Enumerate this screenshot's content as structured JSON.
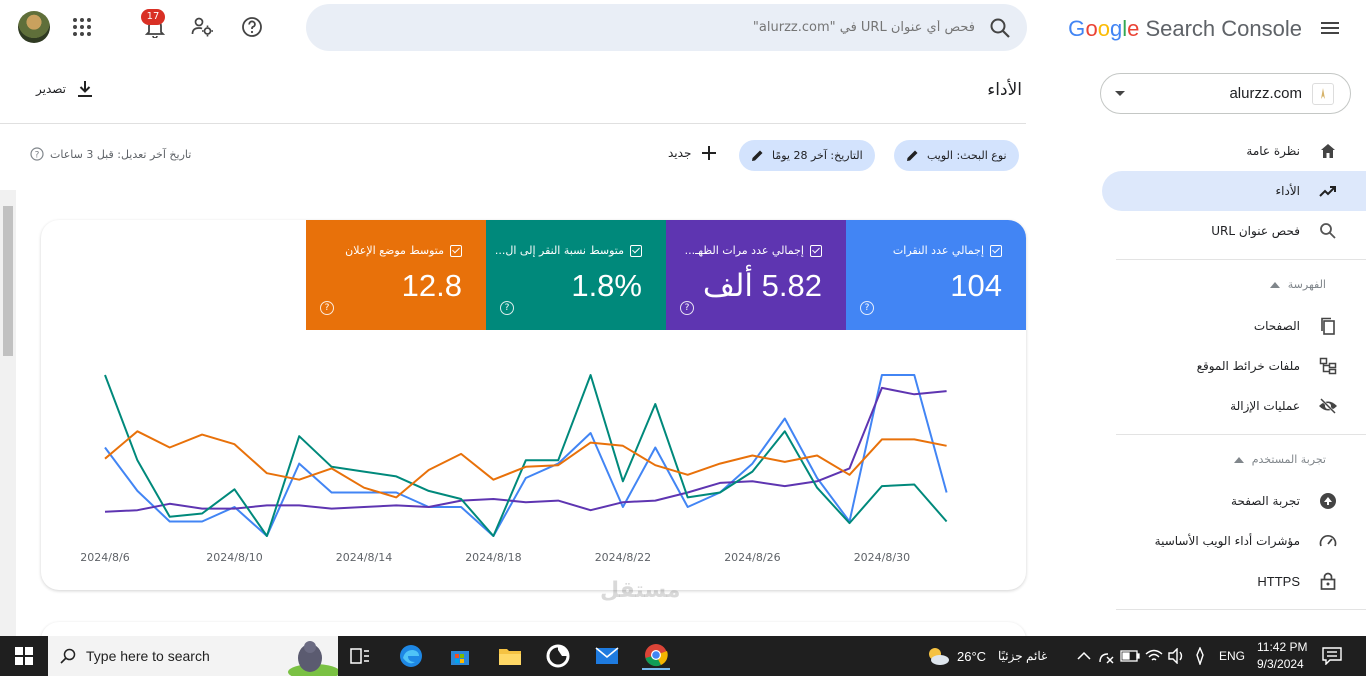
{
  "app": {
    "brand": "Google Search Console"
  },
  "property": {
    "name": "alurzz.com"
  },
  "search": {
    "placeholder": "فحص أي عنوان URL في \"alurzz.com\""
  },
  "notifications": {
    "count": "17"
  },
  "header": {
    "title": "الأداء",
    "export_label": "تصدير"
  },
  "filters": {
    "search_type": "نوع البحث: الويب",
    "date": "التاريخ: آخر 28 يومًا",
    "new_label": "جديد",
    "updated": "تاريخ آخر تعديل: قبل 3 ساعات"
  },
  "sidebar": {
    "items": [
      {
        "label": "نظرة عامة",
        "icon": "home-icon"
      },
      {
        "label": "الأداء",
        "icon": "trending-up-icon",
        "active": true
      },
      {
        "label": "فحص عنوان URL",
        "icon": "search-icon"
      }
    ],
    "sections": [
      {
        "title": "الفهرسة",
        "items": [
          {
            "label": "الصفحات",
            "icon": "pages-icon"
          },
          {
            "label": "ملفات خرائط الموقع",
            "icon": "sitemap-icon"
          },
          {
            "label": "عمليات الإزالة",
            "icon": "eye-off-icon"
          }
        ]
      },
      {
        "title": "تجربة المستخدم",
        "items": [
          {
            "label": "تجربة الصفحة",
            "icon": "page-experience-icon"
          },
          {
            "label": "مؤشرات أداء الويب الأساسية",
            "icon": "speed-icon"
          },
          {
            "label": "HTTPS",
            "icon": "lock-icon"
          }
        ]
      }
    ]
  },
  "metrics": [
    {
      "label": "إجمالي عدد النقرات",
      "value": "104",
      "color": "#4285f4"
    },
    {
      "label": "إجمالي عدد مرات الظهـ...",
      "value": "5.82 ألف",
      "color": "#5e35b1"
    },
    {
      "label": "متوسط نسبة النقر إلى ال...",
      "value": "1.8%",
      "color": "#00897b"
    },
    {
      "label": "متوسط موضع الإعلان",
      "value": "12.8",
      "color": "#e8710a"
    }
  ],
  "chart_data": {
    "type": "line",
    "title": "",
    "xlabel": "",
    "ylabel": "",
    "x": [
      "2024/8/6",
      "2024/8/7",
      "2024/8/8",
      "2024/8/9",
      "2024/8/10",
      "2024/8/11",
      "2024/8/12",
      "2024/8/13",
      "2024/8/14",
      "2024/8/15",
      "2024/8/16",
      "2024/8/17",
      "2024/8/18",
      "2024/8/19",
      "2024/8/20",
      "2024/8/21",
      "2024/8/22",
      "2024/8/23",
      "2024/8/24",
      "2024/8/25",
      "2024/8/26",
      "2024/8/27",
      "2024/8/28",
      "2024/8/29",
      "2024/8/30",
      "2024/8/31",
      "2024/9/1",
      "2024/9/2"
    ],
    "xticks": [
      "2024/8/6",
      "2024/8/10",
      "2024/8/14",
      "2024/8/18",
      "2024/8/22",
      "2024/8/26",
      "2024/8/30"
    ],
    "ylim": [
      0,
      100
    ],
    "grid": false,
    "series": [
      {
        "color": "#4285f4",
        "values": [
          55,
          28,
          9,
          9,
          18,
          0,
          45,
          27,
          27,
          27,
          18,
          18,
          0,
          36,
          45,
          64,
          18,
          55,
          18,
          27,
          45,
          73,
          36,
          9,
          100,
          100,
          27
        ]
      },
      {
        "color": "#5e35b1",
        "values": [
          15,
          16,
          20,
          17,
          17,
          19,
          19,
          17,
          18,
          19,
          18,
          22,
          23,
          21,
          22,
          16,
          21,
          22,
          27,
          33,
          34,
          31,
          34,
          42,
          92,
          88,
          90
        ]
      },
      {
        "color": "#00897b",
        "values": [
          100,
          47,
          12,
          14,
          29,
          0,
          62,
          43,
          40,
          37,
          28,
          23,
          0,
          47,
          47,
          100,
          34,
          82,
          24,
          27,
          40,
          65,
          30,
          8,
          31,
          32,
          9
        ]
      },
      {
        "color": "#e8710a",
        "values": [
          48,
          65,
          55,
          63,
          57,
          39,
          35,
          42,
          30,
          24,
          41,
          51,
          35,
          43,
          44,
          58,
          56,
          44,
          38,
          45,
          50,
          46,
          50,
          38,
          60,
          60,
          56
        ]
      }
    ]
  },
  "taskbar": {
    "search_placeholder": "Type here to search",
    "weather_temp": "26°C",
    "weather_text": "غائم جزئيًا",
    "lang": "ENG",
    "time": "11:42 PM",
    "date": "9/3/2024"
  },
  "watermark": "مستقل"
}
